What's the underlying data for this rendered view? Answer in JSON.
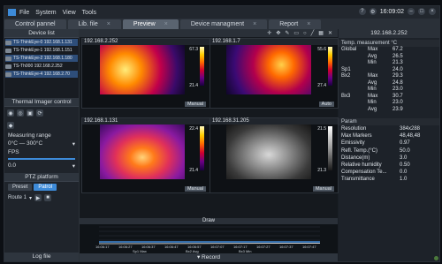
{
  "app": {
    "menu": [
      "File",
      "System",
      "View",
      "Tools"
    ],
    "time": "16:09:02"
  },
  "tabs": [
    {
      "label": "Control pannel"
    },
    {
      "label": "Lib. file"
    },
    {
      "label": "Preview"
    },
    {
      "label": "Device managment"
    },
    {
      "label": "Report"
    }
  ],
  "left": {
    "device_list_title": "Device list",
    "devices": [
      {
        "name": "TS-ThinkEye-0",
        "ip": "192.168.1.131"
      },
      {
        "name": "TS-ThinkEye-1",
        "ip": "192.168.1.151"
      },
      {
        "name": "TS-ThinkEye-2",
        "ip": "192.168.1.180"
      },
      {
        "name": "TS-Th000",
        "ip": "192.168.2.252"
      },
      {
        "name": "TS-ThinkEye-4",
        "ip": "192.168.2.70"
      }
    ],
    "thermal_title": "Thermal Imager control",
    "measuring_range_label": "Measuring range",
    "measuring_range_value": "0°C — 300°C",
    "fps_label": "FPS",
    "fps_value": "0.0",
    "ptz_title": "PTZ platform",
    "preset_label": "Preset",
    "patrol_label": "Patrol",
    "route_label": "Route 1",
    "log_label": "Log file"
  },
  "cells": [
    {
      "ip": "192.168.2.252",
      "top": "67.3",
      "bottom": "21.4",
      "mode": "Manual"
    },
    {
      "ip": "192.168.1.7",
      "top": "55.6",
      "bottom": "27.4",
      "mode": "Auto"
    },
    {
      "ip": "192.168.1.131",
      "top": "22.4",
      "bottom": "21.4",
      "mode": "Manual"
    },
    {
      "ip": "192.168.31.205",
      "top": "21.5",
      "bottom": "21.3",
      "mode": "Manual"
    }
  ],
  "center": {
    "draw_label": "Draw",
    "record_label": "Record",
    "chart_times": [
      "16:06:17",
      "16:06:27",
      "16:06:37",
      "16:06:47",
      "16:06:57",
      "16:07:07",
      "16:07:17",
      "16:07:27",
      "16:07:37",
      "16:07:47"
    ],
    "legend": [
      "Sp1 Max",
      "Bx2 Avg",
      "Bx3 Min"
    ]
  },
  "right": {
    "ip": "192.168.2.252",
    "temp_title": "Temp. measurement °C",
    "temps": [
      {
        "a": "Global",
        "b": "Max",
        "c": "67.2"
      },
      {
        "a": "",
        "b": "Avg",
        "c": "26.5"
      },
      {
        "a": "",
        "b": "Min",
        "c": "21.3"
      },
      {
        "a": "Sp1",
        "b": "",
        "c": "24.0"
      },
      {
        "a": "Bx2",
        "b": "Max",
        "c": "29.3"
      },
      {
        "a": "",
        "b": "Avg",
        "c": "24.8"
      },
      {
        "a": "",
        "b": "Min",
        "c": "23.0"
      },
      {
        "a": "Bx3",
        "b": "Max",
        "c": "30.7"
      },
      {
        "a": "",
        "b": "Min",
        "c": "23.0"
      },
      {
        "a": "",
        "b": "Avg",
        "c": "23.9"
      }
    ],
    "param_title": "Param",
    "params": [
      {
        "k": "Resolution",
        "v": "384x288"
      },
      {
        "k": "Max Markers",
        "v": "48,48,48"
      },
      {
        "k": "Emissivity",
        "v": "0.97"
      },
      {
        "k": "Refl. Temp.(°C)",
        "v": "50.0"
      },
      {
        "k": "Distance(m)",
        "v": "3.0"
      },
      {
        "k": "Relative humidity",
        "v": "0.50"
      },
      {
        "k": "Compensation Te...",
        "v": "0.0"
      },
      {
        "k": "Transmittance",
        "v": "1.0"
      }
    ]
  },
  "colors": {
    "accent": "#3d8bd9",
    "tab_active": "#5a6470"
  }
}
